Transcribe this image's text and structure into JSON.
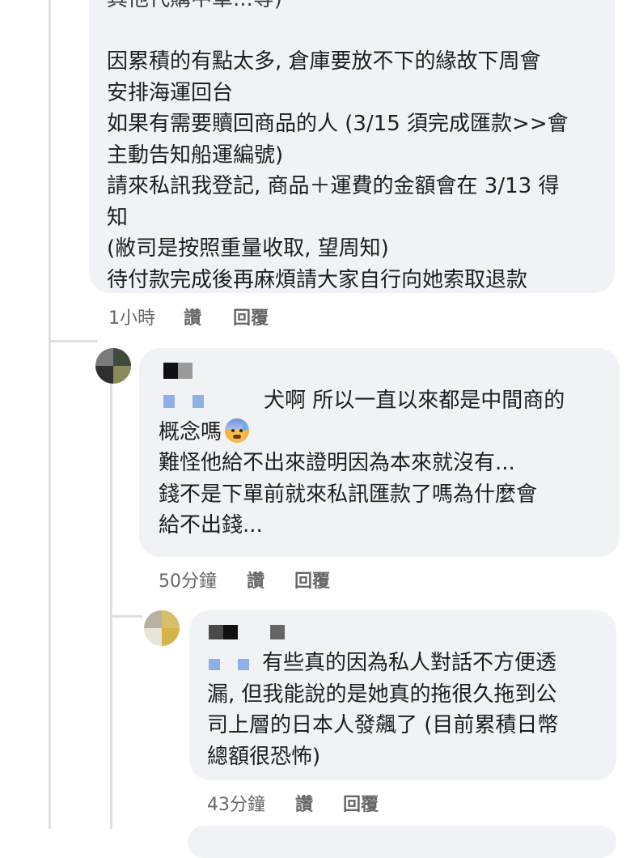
{
  "comment1": {
    "partial_first_line": "其他代購中單...等)",
    "lines": [
      "",
      "因累積的有點太多, 倉庫要放不下的緣故下周會",
      "安排海運回台",
      "如果有需要贖回商品的人 (3/15 須完成匯款>>會",
      "主動告知船運編號)",
      "請來私訊我登記, 商品＋運費的金額會在 3/13 得",
      "知",
      "(敝司是按照重量收取, 望周知)",
      "待付款完成後再麻煩請大家自行向她索取退款"
    ],
    "time": "1小時",
    "like": "讚",
    "reply": "回覆"
  },
  "comment2": {
    "first_line_text": "犬啊 所以一直以來都是中間商的",
    "line2_text": "概念嗎",
    "line2_emoji": "anxious-face-with-sweat-icon",
    "lines": [
      "難怪他給不出來證明因為本來就沒有...",
      "錢不是下單前就來私訊匯款了嗎為什麼會",
      "給不出錢..."
    ],
    "time": "50分鐘",
    "like": "讚",
    "reply": "回覆"
  },
  "comment3": {
    "first_line_text": "有些真的因為私人對話不方便透",
    "lines": [
      "漏, 但我能說的是她真的拖很久拖到公",
      "司上層的日本人發飆了 (目前累積日幣",
      "總額很恐怖)"
    ],
    "time": "43分鐘",
    "like": "讚",
    "reply": "回覆"
  },
  "colors": {
    "bubble_bg": "#f0f2f5",
    "text": "#1c1e21",
    "meta": "#65676b",
    "censor_dark": "#1a1a1a",
    "censor_gray": "#8e8e8e",
    "censor_blue": "#8fb0e6"
  }
}
